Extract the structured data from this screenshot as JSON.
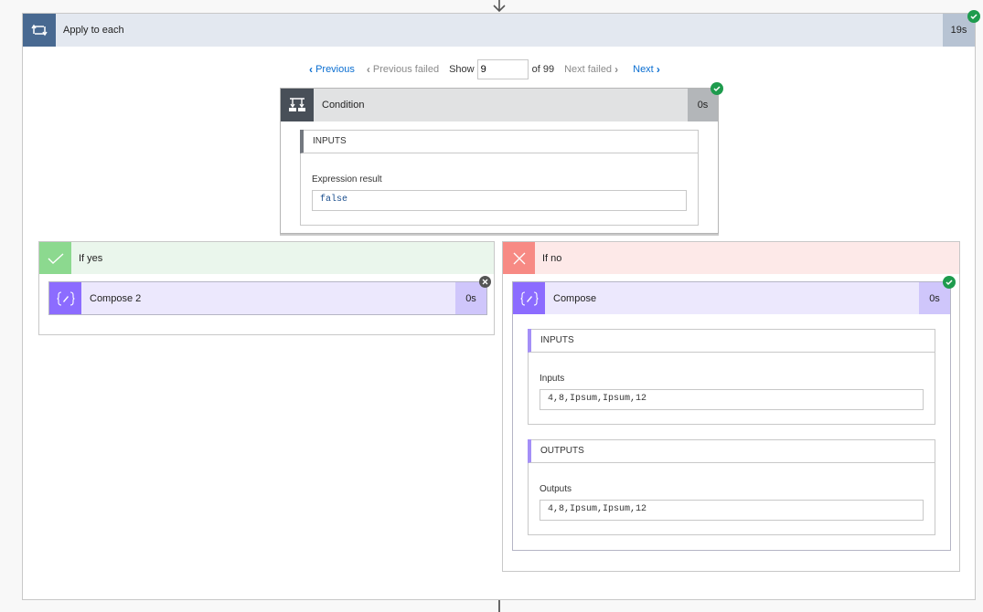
{
  "loop": {
    "title": "Apply to each",
    "duration": "19s",
    "status": "succeeded",
    "icon": "loop-icon"
  },
  "pager": {
    "previous": "Previous",
    "previous_failed": "Previous failed",
    "show_label": "Show",
    "current": "9",
    "of_total": "of 99",
    "next_failed": "Next failed",
    "next": "Next"
  },
  "condition": {
    "title": "Condition",
    "duration": "0s",
    "status": "succeeded",
    "inputs_header": "INPUTS",
    "expression_label": "Expression result",
    "expression_value": "false"
  },
  "if_yes": {
    "title": "If yes",
    "action": {
      "title": "Compose 2",
      "duration": "0s",
      "status": "skipped"
    }
  },
  "if_no": {
    "title": "If no",
    "action": {
      "title": "Compose",
      "duration": "0s",
      "status": "succeeded",
      "inputs_header": "INPUTS",
      "inputs_label": "Inputs",
      "inputs_value": "4,8,Ipsum,Ipsum,12",
      "outputs_header": "OUTPUTS",
      "outputs_label": "Outputs",
      "outputs_value": "4,8,Ipsum,Ipsum,12"
    }
  },
  "colors": {
    "loop_accent": "#486991",
    "condition_accent": "#484f58",
    "compose_accent": "#8c6cff",
    "yes_accent": "#8cd98f",
    "no_accent": "#f78a84",
    "success": "#1e9b4d",
    "link": "#0a6ed1"
  }
}
